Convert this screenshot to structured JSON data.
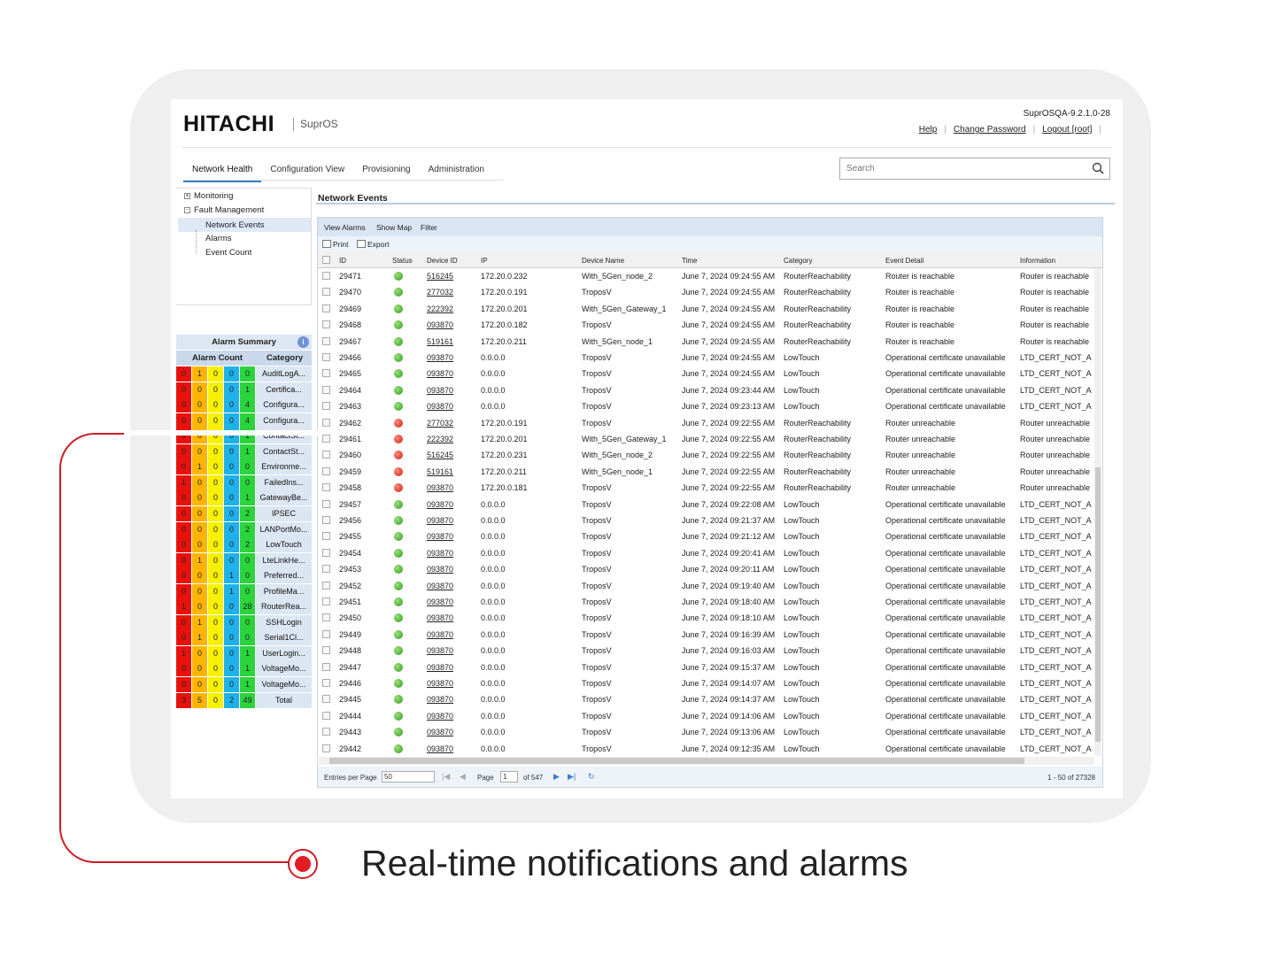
{
  "header": {
    "brand": "HITACHI",
    "product": "SuprOS",
    "version": "SuprOSQA-9.2.1.0-28",
    "links": [
      "Help",
      "Change Password",
      "Logout [root]"
    ]
  },
  "nav": {
    "tabs": [
      "Network Health",
      "Configuration View",
      "Provisioning",
      "Administration"
    ],
    "active": 0
  },
  "search": {
    "placeholder": "Search"
  },
  "tree": {
    "items": [
      {
        "label": "Monitoring",
        "expander": "+"
      },
      {
        "label": "Fault Management",
        "expander": "-"
      },
      {
        "label": "Network Events"
      },
      {
        "label": "Alarms"
      },
      {
        "label": "Event Count"
      }
    ]
  },
  "alarm_summary": {
    "title": "Alarm Summary",
    "col_count": "Alarm Count",
    "col_category": "Category",
    "severity_colors": [
      "#e8120c",
      "#ffb500",
      "#f7f000",
      "#1fb2ea",
      "#2ad43a"
    ],
    "rows": [
      {
        "counts": [
          "0",
          "1",
          "0",
          "0",
          "0"
        ],
        "category": "AuditLogA..."
      },
      {
        "counts": [
          "0",
          "0",
          "0",
          "0",
          "1"
        ],
        "category": "Certifica..."
      },
      {
        "counts": [
          "0",
          "0",
          "0",
          "0",
          "4"
        ],
        "category": "Configura..."
      },
      {
        "counts": [
          "0",
          "0",
          "0",
          "0",
          "4"
        ],
        "category": "Configura..."
      },
      {
        "counts": [
          "0",
          "0",
          "0",
          "0",
          "1"
        ],
        "category": "ContactSt..."
      },
      {
        "counts": [
          "0",
          "0",
          "0",
          "0",
          "1"
        ],
        "category": "ContactSt..."
      },
      {
        "counts": [
          "0",
          "1",
          "0",
          "0",
          "0"
        ],
        "category": "Environme..."
      },
      {
        "counts": [
          "1",
          "0",
          "0",
          "0",
          "0"
        ],
        "category": "FailedIns..."
      },
      {
        "counts": [
          "0",
          "0",
          "0",
          "0",
          "1"
        ],
        "category": "GatewayBe..."
      },
      {
        "counts": [
          "0",
          "0",
          "0",
          "0",
          "2"
        ],
        "category": "IPSEC"
      },
      {
        "counts": [
          "0",
          "0",
          "0",
          "0",
          "2"
        ],
        "category": "LANPortMo..."
      },
      {
        "counts": [
          "0",
          "0",
          "0",
          "0",
          "2"
        ],
        "category": "LowTouch"
      },
      {
        "counts": [
          "0",
          "1",
          "0",
          "0",
          "0"
        ],
        "category": "LteLinkHe..."
      },
      {
        "counts": [
          "0",
          "0",
          "0",
          "1",
          "0"
        ],
        "category": "Preferred..."
      },
      {
        "counts": [
          "0",
          "0",
          "0",
          "1",
          "0"
        ],
        "category": "ProfileMa..."
      },
      {
        "counts": [
          "1",
          "0",
          "0",
          "0",
          "28"
        ],
        "category": "RouterRea..."
      },
      {
        "counts": [
          "0",
          "1",
          "0",
          "0",
          "0"
        ],
        "category": "SSHLogin"
      },
      {
        "counts": [
          "0",
          "1",
          "0",
          "0",
          "0"
        ],
        "category": "Serial1Cl..."
      },
      {
        "counts": [
          "1",
          "0",
          "0",
          "0",
          "1"
        ],
        "category": "UserLogin..."
      },
      {
        "counts": [
          "0",
          "0",
          "0",
          "0",
          "1"
        ],
        "category": "VoltageMo..."
      },
      {
        "counts": [
          "0",
          "0",
          "0",
          "0",
          "1"
        ],
        "category": "VoltageMo..."
      },
      {
        "counts": [
          "3",
          "5",
          "0",
          "2",
          "49"
        ],
        "category": "Total"
      }
    ]
  },
  "main": {
    "title": "Network Events",
    "toolbar": [
      "View Alarms",
      "Show Map",
      "Filter"
    ],
    "actions": [
      "Print",
      "Export"
    ],
    "columns": [
      "ID",
      "Status",
      "Device ID",
      "IP",
      "Device Name",
      "Time",
      "Category",
      "Event Detail",
      "Information"
    ],
    "status_colors": {
      "green": "#2e9b1e",
      "red": "#d51d0e"
    },
    "rows": [
      {
        "id": "29471",
        "status": "green",
        "device_id": "516245",
        "ip": "172.20.0.232",
        "name": "With_5Gen_node_2",
        "time": "June 7, 2024 09:24:55 AM",
        "category": "RouterReachability",
        "detail": "Router is reachable",
        "info": "Router is reachable"
      },
      {
        "id": "29470",
        "status": "green",
        "device_id": "277032",
        "ip": "172.20.0.191",
        "name": "TroposV",
        "time": "June 7, 2024 09:24:55 AM",
        "category": "RouterReachability",
        "detail": "Router is reachable",
        "info": "Router is reachable"
      },
      {
        "id": "29469",
        "status": "green",
        "device_id": "222392",
        "ip": "172.20.0.201",
        "name": "With_5Gen_Gateway_1",
        "time": "June 7, 2024 09:24:55 AM",
        "category": "RouterReachability",
        "detail": "Router is reachable",
        "info": "Router is reachable"
      },
      {
        "id": "29468",
        "status": "green",
        "device_id": "093870",
        "ip": "172.20.0.182",
        "name": "TroposV",
        "time": "June 7, 2024 09:24:55 AM",
        "category": "RouterReachability",
        "detail": "Router is reachable",
        "info": "Router is reachable"
      },
      {
        "id": "29467",
        "status": "green",
        "device_id": "519161",
        "ip": "172.20.0.211",
        "name": "With_5Gen_node_1",
        "time": "June 7, 2024 09:24:55 AM",
        "category": "RouterReachability",
        "detail": "Router is reachable",
        "info": "Router is reachable"
      },
      {
        "id": "29466",
        "status": "green",
        "device_id": "093870",
        "ip": "0.0.0.0",
        "name": "TroposV",
        "time": "June 7, 2024 09:24:55 AM",
        "category": "LowTouch",
        "detail": "Operational certificate unavailable",
        "info": "LTD_CERT_NOT_A"
      },
      {
        "id": "29465",
        "status": "green",
        "device_id": "093870",
        "ip": "0.0.0.0",
        "name": "TroposV",
        "time": "June 7, 2024 09:24:55 AM",
        "category": "LowTouch",
        "detail": "Operational certificate unavailable",
        "info": "LTD_CERT_NOT_A"
      },
      {
        "id": "29464",
        "status": "green",
        "device_id": "093870",
        "ip": "0.0.0.0",
        "name": "TroposV",
        "time": "June 7, 2024 09:23:44 AM",
        "category": "LowTouch",
        "detail": "Operational certificate unavailable",
        "info": "LTD_CERT_NOT_A"
      },
      {
        "id": "29463",
        "status": "green",
        "device_id": "093870",
        "ip": "0.0.0.0",
        "name": "TroposV",
        "time": "June 7, 2024 09:23:13 AM",
        "category": "LowTouch",
        "detail": "Operational certificate unavailable",
        "info": "LTD_CERT_NOT_A"
      },
      {
        "id": "29462",
        "status": "red",
        "device_id": "277032",
        "ip": "172.20.0.191",
        "name": "TroposV",
        "time": "June 7, 2024 09:22:55 AM",
        "category": "RouterReachability",
        "detail": "Router unreachable",
        "info": "Router unreachable"
      },
      {
        "id": "29461",
        "status": "red",
        "device_id": "222392",
        "ip": "172.20.0.201",
        "name": "With_5Gen_Gateway_1",
        "time": "June 7, 2024 09:22:55 AM",
        "category": "RouterReachability",
        "detail": "Router unreachable",
        "info": "Router unreachable"
      },
      {
        "id": "29460",
        "status": "red",
        "device_id": "516245",
        "ip": "172.20.0.231",
        "name": "With_5Gen_node_2",
        "time": "June 7, 2024 09:22:55 AM",
        "category": "RouterReachability",
        "detail": "Router unreachable",
        "info": "Router unreachable"
      },
      {
        "id": "29459",
        "status": "red",
        "device_id": "519161",
        "ip": "172.20.0.211",
        "name": "With_5Gen_node_1",
        "time": "June 7, 2024 09:22:55 AM",
        "category": "RouterReachability",
        "detail": "Router unreachable",
        "info": "Router unreachable"
      },
      {
        "id": "29458",
        "status": "red",
        "device_id": "093870",
        "ip": "172.20.0.181",
        "name": "TroposV",
        "time": "June 7, 2024 09:22:55 AM",
        "category": "RouterReachability",
        "detail": "Router unreachable",
        "info": "Router unreachable"
      },
      {
        "id": "29457",
        "status": "green",
        "device_id": "093870",
        "ip": "0.0.0.0",
        "name": "TroposV",
        "time": "June 7, 2024 09:22:08 AM",
        "category": "LowTouch",
        "detail": "Operational certificate unavailable",
        "info": "LTD_CERT_NOT_A"
      },
      {
        "id": "29456",
        "status": "green",
        "device_id": "093870",
        "ip": "0.0.0.0",
        "name": "TroposV",
        "time": "June 7, 2024 09:21:37 AM",
        "category": "LowTouch",
        "detail": "Operational certificate unavailable",
        "info": "LTD_CERT_NOT_A"
      },
      {
        "id": "29455",
        "status": "green",
        "device_id": "093870",
        "ip": "0.0.0.0",
        "name": "TroposV",
        "time": "June 7, 2024 09:21:12 AM",
        "category": "LowTouch",
        "detail": "Operational certificate unavailable",
        "info": "LTD_CERT_NOT_A"
      },
      {
        "id": "29454",
        "status": "green",
        "device_id": "093870",
        "ip": "0.0.0.0",
        "name": "TroposV",
        "time": "June 7, 2024 09:20:41 AM",
        "category": "LowTouch",
        "detail": "Operational certificate unavailable",
        "info": "LTD_CERT_NOT_A"
      },
      {
        "id": "29453",
        "status": "green",
        "device_id": "093870",
        "ip": "0.0.0.0",
        "name": "TroposV",
        "time": "June 7, 2024 09:20:11 AM",
        "category": "LowTouch",
        "detail": "Operational certificate unavailable",
        "info": "LTD_CERT_NOT_A"
      },
      {
        "id": "29452",
        "status": "green",
        "device_id": "093870",
        "ip": "0.0.0.0",
        "name": "TroposV",
        "time": "June 7, 2024 09:19:40 AM",
        "category": "LowTouch",
        "detail": "Operational certificate unavailable",
        "info": "LTD_CERT_NOT_A"
      },
      {
        "id": "29451",
        "status": "green",
        "device_id": "093870",
        "ip": "0.0.0.0",
        "name": "TroposV",
        "time": "June 7, 2024 09:18:40 AM",
        "category": "LowTouch",
        "detail": "Operational certificate unavailable",
        "info": "LTD_CERT_NOT_A"
      },
      {
        "id": "29450",
        "status": "green",
        "device_id": "093870",
        "ip": "0.0.0.0",
        "name": "TroposV",
        "time": "June 7, 2024 09:18:10 AM",
        "category": "LowTouch",
        "detail": "Operational certificate unavailable",
        "info": "LTD_CERT_NOT_A"
      },
      {
        "id": "29449",
        "status": "green",
        "device_id": "093870",
        "ip": "0.0.0.0",
        "name": "TroposV",
        "time": "June 7, 2024 09:16:39 AM",
        "category": "LowTouch",
        "detail": "Operational certificate unavailable",
        "info": "LTD_CERT_NOT_A"
      },
      {
        "id": "29448",
        "status": "green",
        "device_id": "093870",
        "ip": "0.0.0.0",
        "name": "TroposV",
        "time": "June 7, 2024 09:16:03 AM",
        "category": "LowTouch",
        "detail": "Operational certificate unavailable",
        "info": "LTD_CERT_NOT_A"
      },
      {
        "id": "29447",
        "status": "green",
        "device_id": "093870",
        "ip": "0.0.0.0",
        "name": "TroposV",
        "time": "June 7, 2024 09:15:37 AM",
        "category": "LowTouch",
        "detail": "Operational certificate unavailable",
        "info": "LTD_CERT_NOT_A"
      },
      {
        "id": "29446",
        "status": "green",
        "device_id": "093870",
        "ip": "0.0.0.0",
        "name": "TroposV",
        "time": "June 7, 2024 09:14:07 AM",
        "category": "LowTouch",
        "detail": "Operational certificate unavailable",
        "info": "LTD_CERT_NOT_A"
      },
      {
        "id": "29445",
        "status": "green",
        "device_id": "093870",
        "ip": "0.0.0.0",
        "name": "TroposV",
        "time": "June 7, 2024 09:14:37 AM",
        "category": "LowTouch",
        "detail": "Operational certificate unavailable",
        "info": "LTD_CERT_NOT_A"
      },
      {
        "id": "29444",
        "status": "green",
        "device_id": "093870",
        "ip": "0.0.0.0",
        "name": "TroposV",
        "time": "June 7, 2024 09:14:06 AM",
        "category": "LowTouch",
        "detail": "Operational certificate unavailable",
        "info": "LTD_CERT_NOT_A"
      },
      {
        "id": "29443",
        "status": "green",
        "device_id": "093870",
        "ip": "0.0.0.0",
        "name": "TroposV",
        "time": "June 7, 2024 09:13:06 AM",
        "category": "LowTouch",
        "detail": "Operational certificate unavailable",
        "info": "LTD_CERT_NOT_A"
      },
      {
        "id": "29442",
        "status": "green",
        "device_id": "093870",
        "ip": "0.0.0.0",
        "name": "TroposV",
        "time": "June 7, 2024 09:12:35 AM",
        "category": "LowTouch",
        "detail": "Operational certificate unavailable",
        "info": "LTD_CERT_NOT_A"
      }
    ],
    "pager": {
      "entries_label": "Entries per Page",
      "entries_value": "50",
      "page_label": "Page",
      "page_value": "1",
      "of_label": "of 547",
      "range": "1 - 50 of 27328"
    }
  },
  "callout": {
    "text": "Real-time notifications and alarms",
    "color": "#cc1d24"
  }
}
